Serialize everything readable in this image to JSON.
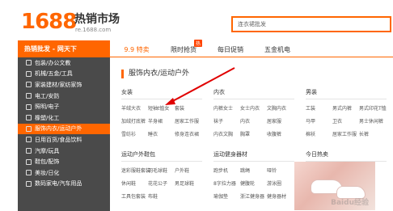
{
  "header": {
    "logo": "1688",
    "site_name": "热销市场",
    "url": "re.1688.com",
    "search_placeholder": "连衣裙批发"
  },
  "nav": {
    "category_head": "热销批发 - 网天下",
    "tabs": [
      {
        "label": "9.9 特卖",
        "active": true
      },
      {
        "label": "限时抢货",
        "badge": "热"
      },
      {
        "label": "每日促销"
      },
      {
        "label": "五金机电"
      }
    ]
  },
  "sidebar": {
    "items": [
      {
        "label": "包装/办公文教"
      },
      {
        "label": "机械/五金/工具"
      },
      {
        "label": "家装建材/家纺家饰"
      },
      {
        "label": "电工/安防"
      },
      {
        "label": "照明/电子"
      },
      {
        "label": "橡塑/化工"
      },
      {
        "label": "服饰内衣/运动户外",
        "active": true
      },
      {
        "label": "日用百货/食品饮料"
      },
      {
        "label": "汽摩/玩具"
      },
      {
        "label": "鞋包/配饰"
      },
      {
        "label": "美妆/日化"
      },
      {
        "label": "数码家电/汽车用品"
      }
    ]
  },
  "main": {
    "title": "服饰内衣/运动户外",
    "sections": [
      {
        "title": "女装",
        "items": [
          "羊绒大衣",
          "短袖t恤女",
          "套装",
          "加绒打底裤",
          "半身裙",
          "居家工作服",
          "雪纺衫",
          "睡衣",
          "修身连衣裙"
        ]
      },
      {
        "title": "内衣",
        "items": [
          "内裤女士",
          "女士内衣",
          "文胸内衣",
          "袜子",
          "内衣",
          "居家服",
          "内衣文胸",
          "胸罩",
          "收腹裤"
        ]
      },
      {
        "title": "男装",
        "items": [
          "工装",
          "男式内裤",
          "男式印花T恤",
          "马甲",
          "卫衣",
          "男士休闲裤",
          "棉袄",
          "居家工作服",
          "长裤"
        ]
      },
      {
        "title": "运动户外鞋包",
        "items": [
          "迷彩服鞋套装",
          "羽毛球鞋",
          "户外鞋",
          "休闲鞋",
          "花花公子",
          "男足球鞋",
          "工具包套装",
          "布鞋"
        ]
      },
      {
        "title": "运动健身器材",
        "items": [
          "跑步机",
          "跳绳",
          "哑铃",
          "8字拉力器",
          "健腹轮",
          "游泳圈",
          "瑜伽垫",
          "浙江健身器",
          "健身器材"
        ]
      },
      {
        "title": "今日热卖",
        "items": []
      }
    ]
  },
  "watermark": "Baidu经验"
}
